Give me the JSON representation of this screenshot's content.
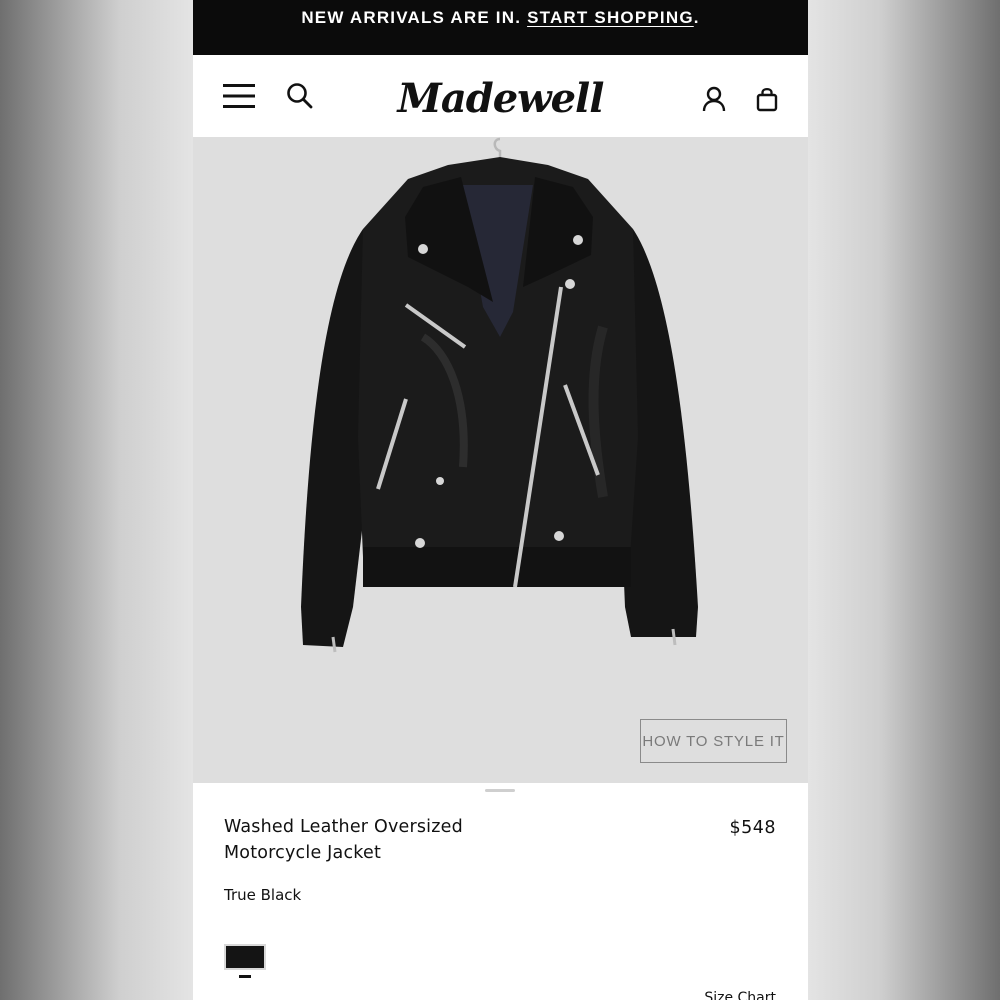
{
  "promo": {
    "text": "NEW ARRIVALS ARE IN.",
    "link": "START SHOPPING",
    "suffix": "."
  },
  "header": {
    "logo": "Madewell",
    "icons": [
      "menu-icon",
      "search-icon",
      "account-icon",
      "bag-icon"
    ]
  },
  "hero": {
    "style_button": "HOW TO STYLE IT",
    "background": "#dedede"
  },
  "product": {
    "title_line1": "Washed Leather Oversized",
    "title_line2": "Motorcycle Jacket",
    "price": "$548",
    "color": "True Black",
    "swatch_color": "#141414",
    "size_chart": "Size Chart"
  }
}
